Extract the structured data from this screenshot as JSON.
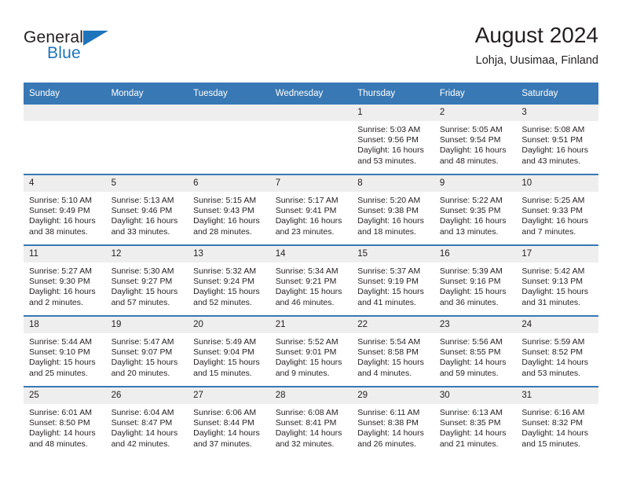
{
  "brand": {
    "name_part1": "General",
    "name_part2": "Blue",
    "logo_icon": "triangle-icon",
    "accent_color": "#1d74bb"
  },
  "header": {
    "title": "August 2024",
    "subtitle": "Lohja, Uusimaa, Finland"
  },
  "theme": {
    "header_row_background": "#3878b4",
    "daynum_background": "#eeeeee",
    "text_color": "#231f20"
  },
  "calendar": {
    "weekday_headers": [
      "Sunday",
      "Monday",
      "Tuesday",
      "Wednesday",
      "Thursday",
      "Friday",
      "Saturday"
    ],
    "weeks": [
      [
        {
          "day": "",
          "empty": true,
          "sunrise": "",
          "sunset": "",
          "daylight_line1": "",
          "daylight_line2": ""
        },
        {
          "day": "",
          "empty": true,
          "sunrise": "",
          "sunset": "",
          "daylight_line1": "",
          "daylight_line2": ""
        },
        {
          "day": "",
          "empty": true,
          "sunrise": "",
          "sunset": "",
          "daylight_line1": "",
          "daylight_line2": ""
        },
        {
          "day": "",
          "empty": true,
          "sunrise": "",
          "sunset": "",
          "daylight_line1": "",
          "daylight_line2": ""
        },
        {
          "day": "1",
          "sunrise": "Sunrise: 5:03 AM",
          "sunset": "Sunset: 9:56 PM",
          "daylight_line1": "Daylight: 16 hours",
          "daylight_line2": "and 53 minutes."
        },
        {
          "day": "2",
          "sunrise": "Sunrise: 5:05 AM",
          "sunset": "Sunset: 9:54 PM",
          "daylight_line1": "Daylight: 16 hours",
          "daylight_line2": "and 48 minutes."
        },
        {
          "day": "3",
          "sunrise": "Sunrise: 5:08 AM",
          "sunset": "Sunset: 9:51 PM",
          "daylight_line1": "Daylight: 16 hours",
          "daylight_line2": "and 43 minutes."
        }
      ],
      [
        {
          "day": "4",
          "sunrise": "Sunrise: 5:10 AM",
          "sunset": "Sunset: 9:49 PM",
          "daylight_line1": "Daylight: 16 hours",
          "daylight_line2": "and 38 minutes."
        },
        {
          "day": "5",
          "sunrise": "Sunrise: 5:13 AM",
          "sunset": "Sunset: 9:46 PM",
          "daylight_line1": "Daylight: 16 hours",
          "daylight_line2": "and 33 minutes."
        },
        {
          "day": "6",
          "sunrise": "Sunrise: 5:15 AM",
          "sunset": "Sunset: 9:43 PM",
          "daylight_line1": "Daylight: 16 hours",
          "daylight_line2": "and 28 minutes."
        },
        {
          "day": "7",
          "sunrise": "Sunrise: 5:17 AM",
          "sunset": "Sunset: 9:41 PM",
          "daylight_line1": "Daylight: 16 hours",
          "daylight_line2": "and 23 minutes."
        },
        {
          "day": "8",
          "sunrise": "Sunrise: 5:20 AM",
          "sunset": "Sunset: 9:38 PM",
          "daylight_line1": "Daylight: 16 hours",
          "daylight_line2": "and 18 minutes."
        },
        {
          "day": "9",
          "sunrise": "Sunrise: 5:22 AM",
          "sunset": "Sunset: 9:35 PM",
          "daylight_line1": "Daylight: 16 hours",
          "daylight_line2": "and 13 minutes."
        },
        {
          "day": "10",
          "sunrise": "Sunrise: 5:25 AM",
          "sunset": "Sunset: 9:33 PM",
          "daylight_line1": "Daylight: 16 hours",
          "daylight_line2": "and 7 minutes."
        }
      ],
      [
        {
          "day": "11",
          "sunrise": "Sunrise: 5:27 AM",
          "sunset": "Sunset: 9:30 PM",
          "daylight_line1": "Daylight: 16 hours",
          "daylight_line2": "and 2 minutes."
        },
        {
          "day": "12",
          "sunrise": "Sunrise: 5:30 AM",
          "sunset": "Sunset: 9:27 PM",
          "daylight_line1": "Daylight: 15 hours",
          "daylight_line2": "and 57 minutes."
        },
        {
          "day": "13",
          "sunrise": "Sunrise: 5:32 AM",
          "sunset": "Sunset: 9:24 PM",
          "daylight_line1": "Daylight: 15 hours",
          "daylight_line2": "and 52 minutes."
        },
        {
          "day": "14",
          "sunrise": "Sunrise: 5:34 AM",
          "sunset": "Sunset: 9:21 PM",
          "daylight_line1": "Daylight: 15 hours",
          "daylight_line2": "and 46 minutes."
        },
        {
          "day": "15",
          "sunrise": "Sunrise: 5:37 AM",
          "sunset": "Sunset: 9:19 PM",
          "daylight_line1": "Daylight: 15 hours",
          "daylight_line2": "and 41 minutes."
        },
        {
          "day": "16",
          "sunrise": "Sunrise: 5:39 AM",
          "sunset": "Sunset: 9:16 PM",
          "daylight_line1": "Daylight: 15 hours",
          "daylight_line2": "and 36 minutes."
        },
        {
          "day": "17",
          "sunrise": "Sunrise: 5:42 AM",
          "sunset": "Sunset: 9:13 PM",
          "daylight_line1": "Daylight: 15 hours",
          "daylight_line2": "and 31 minutes."
        }
      ],
      [
        {
          "day": "18",
          "sunrise": "Sunrise: 5:44 AM",
          "sunset": "Sunset: 9:10 PM",
          "daylight_line1": "Daylight: 15 hours",
          "daylight_line2": "and 25 minutes."
        },
        {
          "day": "19",
          "sunrise": "Sunrise: 5:47 AM",
          "sunset": "Sunset: 9:07 PM",
          "daylight_line1": "Daylight: 15 hours",
          "daylight_line2": "and 20 minutes."
        },
        {
          "day": "20",
          "sunrise": "Sunrise: 5:49 AM",
          "sunset": "Sunset: 9:04 PM",
          "daylight_line1": "Daylight: 15 hours",
          "daylight_line2": "and 15 minutes."
        },
        {
          "day": "21",
          "sunrise": "Sunrise: 5:52 AM",
          "sunset": "Sunset: 9:01 PM",
          "daylight_line1": "Daylight: 15 hours",
          "daylight_line2": "and 9 minutes."
        },
        {
          "day": "22",
          "sunrise": "Sunrise: 5:54 AM",
          "sunset": "Sunset: 8:58 PM",
          "daylight_line1": "Daylight: 15 hours",
          "daylight_line2": "and 4 minutes."
        },
        {
          "day": "23",
          "sunrise": "Sunrise: 5:56 AM",
          "sunset": "Sunset: 8:55 PM",
          "daylight_line1": "Daylight: 14 hours",
          "daylight_line2": "and 59 minutes."
        },
        {
          "day": "24",
          "sunrise": "Sunrise: 5:59 AM",
          "sunset": "Sunset: 8:52 PM",
          "daylight_line1": "Daylight: 14 hours",
          "daylight_line2": "and 53 minutes."
        }
      ],
      [
        {
          "day": "25",
          "sunrise": "Sunrise: 6:01 AM",
          "sunset": "Sunset: 8:50 PM",
          "daylight_line1": "Daylight: 14 hours",
          "daylight_line2": "and 48 minutes."
        },
        {
          "day": "26",
          "sunrise": "Sunrise: 6:04 AM",
          "sunset": "Sunset: 8:47 PM",
          "daylight_line1": "Daylight: 14 hours",
          "daylight_line2": "and 42 minutes."
        },
        {
          "day": "27",
          "sunrise": "Sunrise: 6:06 AM",
          "sunset": "Sunset: 8:44 PM",
          "daylight_line1": "Daylight: 14 hours",
          "daylight_line2": "and 37 minutes."
        },
        {
          "day": "28",
          "sunrise": "Sunrise: 6:08 AM",
          "sunset": "Sunset: 8:41 PM",
          "daylight_line1": "Daylight: 14 hours",
          "daylight_line2": "and 32 minutes."
        },
        {
          "day": "29",
          "sunrise": "Sunrise: 6:11 AM",
          "sunset": "Sunset: 8:38 PM",
          "daylight_line1": "Daylight: 14 hours",
          "daylight_line2": "and 26 minutes."
        },
        {
          "day": "30",
          "sunrise": "Sunrise: 6:13 AM",
          "sunset": "Sunset: 8:35 PM",
          "daylight_line1": "Daylight: 14 hours",
          "daylight_line2": "and 21 minutes."
        },
        {
          "day": "31",
          "sunrise": "Sunrise: 6:16 AM",
          "sunset": "Sunset: 8:32 PM",
          "daylight_line1": "Daylight: 14 hours",
          "daylight_line2": "and 15 minutes."
        }
      ]
    ]
  }
}
